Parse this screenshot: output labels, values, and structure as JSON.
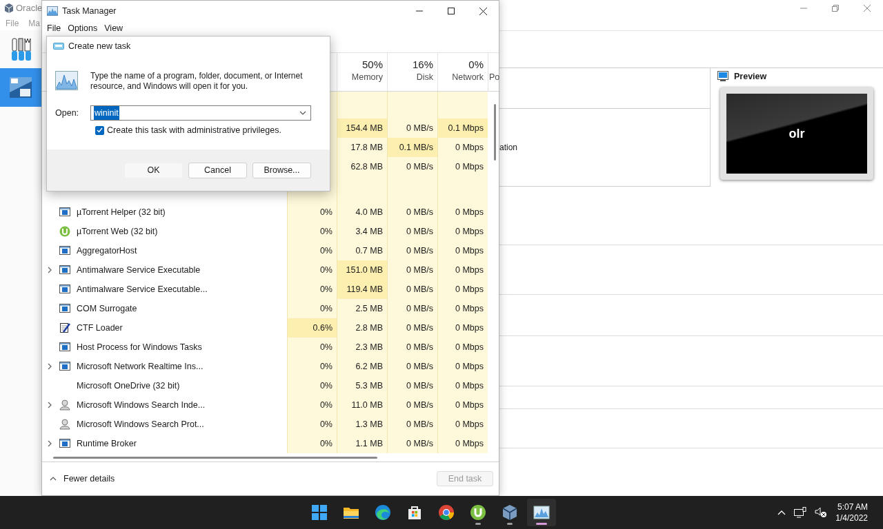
{
  "background_window": {
    "title": "Oracle",
    "menu": [
      "File",
      "Ma"
    ],
    "vm_selected": true,
    "detail_fragment": "ation",
    "preview": {
      "title": "Preview",
      "screen_text": "olr"
    }
  },
  "task_manager": {
    "title": "Task Manager",
    "menu": [
      "File",
      "Options",
      "View"
    ],
    "columns": [
      {
        "percent": "50%",
        "label": "Memory"
      },
      {
        "percent": "16%",
        "label": "Disk"
      },
      {
        "percent": "0%",
        "label": "Network"
      },
      {
        "label": "Po"
      }
    ],
    "app_rows": [
      {
        "cells": [
          {
            "text": "154.4 MB",
            "hot": true
          },
          {
            "text": "0 MB/s",
            "hot": false
          },
          {
            "text": "0.1 Mbps",
            "hot": true
          }
        ]
      },
      {
        "cells": [
          {
            "text": "17.8 MB",
            "hot": false
          },
          {
            "text": "0.1 MB/s",
            "hot": true
          },
          {
            "text": "0 Mbps",
            "hot": false
          }
        ]
      },
      {
        "cells": [
          {
            "text": "62.8 MB",
            "hot": false
          },
          {
            "text": "0 MB/s",
            "hot": false
          },
          {
            "text": "0 Mbps",
            "hot": false
          }
        ]
      }
    ],
    "background_rows": [
      {
        "name": "µTorrent Helper (32 bit)",
        "kind": "window",
        "expandable": false,
        "cells": [
          {
            "text": "0%",
            "hot": false
          },
          {
            "text": "4.0 MB",
            "hot": false
          },
          {
            "text": "0 MB/s",
            "hot": false
          },
          {
            "text": "0 Mbps",
            "hot": false
          }
        ]
      },
      {
        "name": "µTorrent Web (32 bit)",
        "kind": "utorrent",
        "expandable": false,
        "cells": [
          {
            "text": "0%",
            "hot": false
          },
          {
            "text": "3.4 MB",
            "hot": false
          },
          {
            "text": "0 MB/s",
            "hot": false
          },
          {
            "text": "0 Mbps",
            "hot": false
          }
        ]
      },
      {
        "name": "AggregatorHost",
        "kind": "window",
        "expandable": false,
        "cells": [
          {
            "text": "0%",
            "hot": false
          },
          {
            "text": "0.7 MB",
            "hot": false
          },
          {
            "text": "0 MB/s",
            "hot": false
          },
          {
            "text": "0 Mbps",
            "hot": false
          }
        ]
      },
      {
        "name": "Antimalware Service Executable",
        "kind": "window",
        "expandable": true,
        "cells": [
          {
            "text": "0%",
            "hot": false
          },
          {
            "text": "151.0 MB",
            "hot": true
          },
          {
            "text": "0 MB/s",
            "hot": false
          },
          {
            "text": "0 Mbps",
            "hot": false
          }
        ]
      },
      {
        "name": "Antimalware Service Executable...",
        "kind": "window",
        "expandable": false,
        "cells": [
          {
            "text": "0%",
            "hot": false
          },
          {
            "text": "119.4 MB",
            "hot": true
          },
          {
            "text": "0 MB/s",
            "hot": false
          },
          {
            "text": "0 Mbps",
            "hot": false
          }
        ]
      },
      {
        "name": "COM Surrogate",
        "kind": "window",
        "expandable": false,
        "cells": [
          {
            "text": "0%",
            "hot": false
          },
          {
            "text": "2.5 MB",
            "hot": false
          },
          {
            "text": "0 MB/s",
            "hot": false
          },
          {
            "text": "0 Mbps",
            "hot": false
          }
        ]
      },
      {
        "name": "CTF Loader",
        "kind": "notepad",
        "expandable": false,
        "cells": [
          {
            "text": "0.6%",
            "hot": true
          },
          {
            "text": "2.8 MB",
            "hot": false
          },
          {
            "text": "0 MB/s",
            "hot": false
          },
          {
            "text": "0 Mbps",
            "hot": false
          }
        ]
      },
      {
        "name": "Host Process for Windows Tasks",
        "kind": "window",
        "expandable": false,
        "cells": [
          {
            "text": "0%",
            "hot": false
          },
          {
            "text": "2.3 MB",
            "hot": false
          },
          {
            "text": "0 MB/s",
            "hot": false
          },
          {
            "text": "0 Mbps",
            "hot": false
          }
        ]
      },
      {
        "name": "Microsoft Network Realtime Ins...",
        "kind": "window",
        "expandable": true,
        "cells": [
          {
            "text": "0%",
            "hot": false
          },
          {
            "text": "6.2 MB",
            "hot": false
          },
          {
            "text": "0 MB/s",
            "hot": false
          },
          {
            "text": "0 Mbps",
            "hot": false
          }
        ]
      },
      {
        "name": "Microsoft OneDrive (32 bit)",
        "kind": "plain",
        "expandable": false,
        "cells": [
          {
            "text": "0%",
            "hot": false
          },
          {
            "text": "5.3 MB",
            "hot": false
          },
          {
            "text": "0 MB/s",
            "hot": false
          },
          {
            "text": "0 Mbps",
            "hot": false
          }
        ]
      },
      {
        "name": "Microsoft Windows Search Inde...",
        "kind": "person",
        "expandable": true,
        "cells": [
          {
            "text": "0%",
            "hot": false
          },
          {
            "text": "11.0 MB",
            "hot": false
          },
          {
            "text": "0 MB/s",
            "hot": false
          },
          {
            "text": "0 Mbps",
            "hot": false
          }
        ]
      },
      {
        "name": "Microsoft Windows Search Prot...",
        "kind": "person",
        "expandable": false,
        "cells": [
          {
            "text": "0%",
            "hot": false
          },
          {
            "text": "1.3 MB",
            "hot": false
          },
          {
            "text": "0 MB/s",
            "hot": false
          },
          {
            "text": "0 Mbps",
            "hot": false
          }
        ]
      },
      {
        "name": "Runtime Broker",
        "kind": "window",
        "expandable": true,
        "cells": [
          {
            "text": "0%",
            "hot": false
          },
          {
            "text": "1.1 MB",
            "hot": false
          },
          {
            "text": "0 MB/s",
            "hot": false
          },
          {
            "text": "0 Mbps",
            "hot": false
          }
        ]
      }
    ],
    "fewer_details": "Fewer details",
    "end_task": {
      "label": "End task",
      "disabled": true
    }
  },
  "dialog": {
    "title": "Create new task",
    "message": "Type the name of a program, folder, document, or Internet resource, and Windows will open it for you.",
    "open_label": "Open:",
    "open_value": "wininit",
    "text_selected": true,
    "admin": {
      "label": "Create this task with administrative privileges.",
      "checked": true
    },
    "buttons": [
      {
        "label": "OK",
        "default": true
      },
      {
        "label": "Cancel",
        "default": false
      },
      {
        "label": "Browse...",
        "default": false
      }
    ]
  },
  "taskbar": {
    "apps": [
      {
        "kind": "start",
        "running": false,
        "active": false
      },
      {
        "kind": "explorer",
        "running": false,
        "active": false
      },
      {
        "kind": "edge",
        "running": false,
        "active": false
      },
      {
        "kind": "store",
        "running": false,
        "active": false
      },
      {
        "kind": "chrome",
        "running": false,
        "active": false
      },
      {
        "kind": "utorrent",
        "running": true,
        "active": false
      },
      {
        "kind": "virtualbox",
        "running": true,
        "active": false
      },
      {
        "kind": "taskmanager",
        "running": true,
        "active": true
      }
    ],
    "time": "5:07 AM",
    "date": "1/4/2022"
  }
}
